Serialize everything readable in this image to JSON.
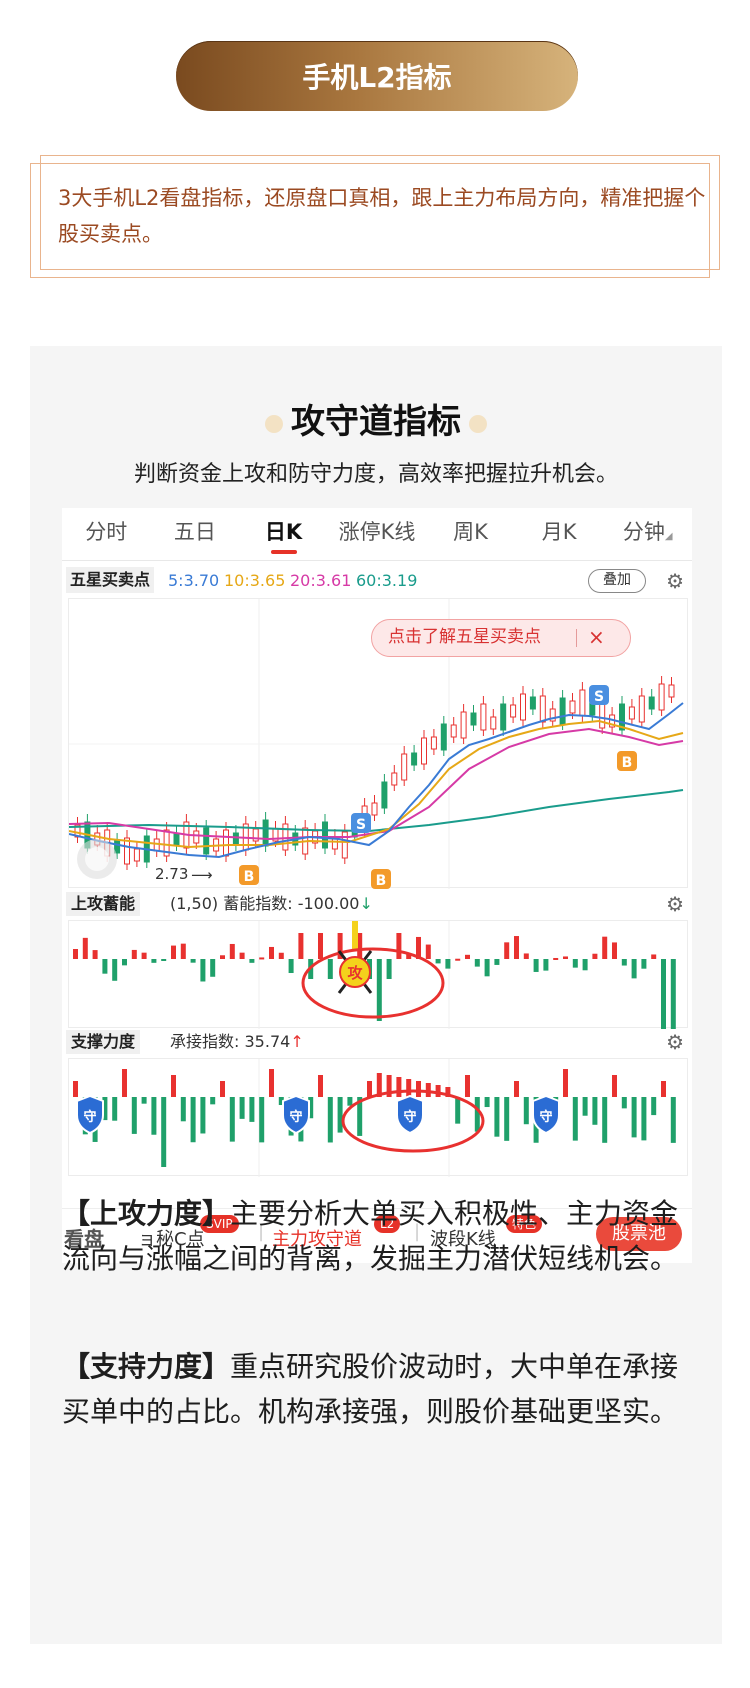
{
  "header": {
    "title": "手机L2指标"
  },
  "intro": {
    "text": "3大手机L2看盘指标，还原盘口真相，跟上主力布局方向，精准把握个股买卖点。"
  },
  "card": {
    "title": "攻守道指标",
    "subtitle": "判断资金上攻和防守力度，高效率把握拉升机会。"
  },
  "app": {
    "tabs": [
      {
        "label": "分时"
      },
      {
        "label": "五日"
      },
      {
        "label": "日K"
      },
      {
        "label": "涨停K线"
      },
      {
        "label": "周K"
      },
      {
        "label": "月K"
      },
      {
        "label": "分钟"
      }
    ],
    "active_tab": "日K",
    "indicator_name": "五星买卖点",
    "ma_values": [
      {
        "text": "5:3.70",
        "color": "#3a7bd5"
      },
      {
        "text": "10:3.65",
        "color": "#e6a817"
      },
      {
        "text": "20:3.61",
        "color": "#d63aa6"
      },
      {
        "text": "60:3.19",
        "color": "#1a9c8c"
      }
    ],
    "overlay_label": "叠加",
    "callout_text": "点击了解五星买卖点",
    "callout_close": "×",
    "min_price_label": "2.73",
    "markers": {
      "buy": "B",
      "sell": "S"
    },
    "attack": {
      "name": "上攻蓄能",
      "params": "(1,50)",
      "label": "蓄能指数:",
      "value": "-100.00",
      "arrow": "↓",
      "icon_text": "攻"
    },
    "support": {
      "name": "支撑力度",
      "label": "承接指数:",
      "value": "35.74",
      "arrow": "↑",
      "icon_text": "守"
    },
    "bottom": {
      "items": [
        {
          "label": "看盘"
        },
        {
          "label": "ョ秘C点",
          "badge": "SVIP"
        },
        {
          "label": "主力攻守道",
          "badge": "L2"
        },
        {
          "label": "波段K线",
          "badge": "特色"
        }
      ],
      "stock_pool": "股票池"
    },
    "colors": {
      "up": "#e8312f",
      "down": "#1fa06a",
      "accent": "#e63228"
    }
  },
  "paragraphs": [
    {
      "heading": "【上攻力度】",
      "body": "主要分析大单买入积极性、主力资金流向与涨幅之间的背离，发掘主力潜伏短线机会。"
    },
    {
      "heading": "【支持力度】",
      "body": "重点研究股价波动时，大中单在承接买单中的占比。机构承接强，则股价基础更坚实。"
    }
  ]
}
